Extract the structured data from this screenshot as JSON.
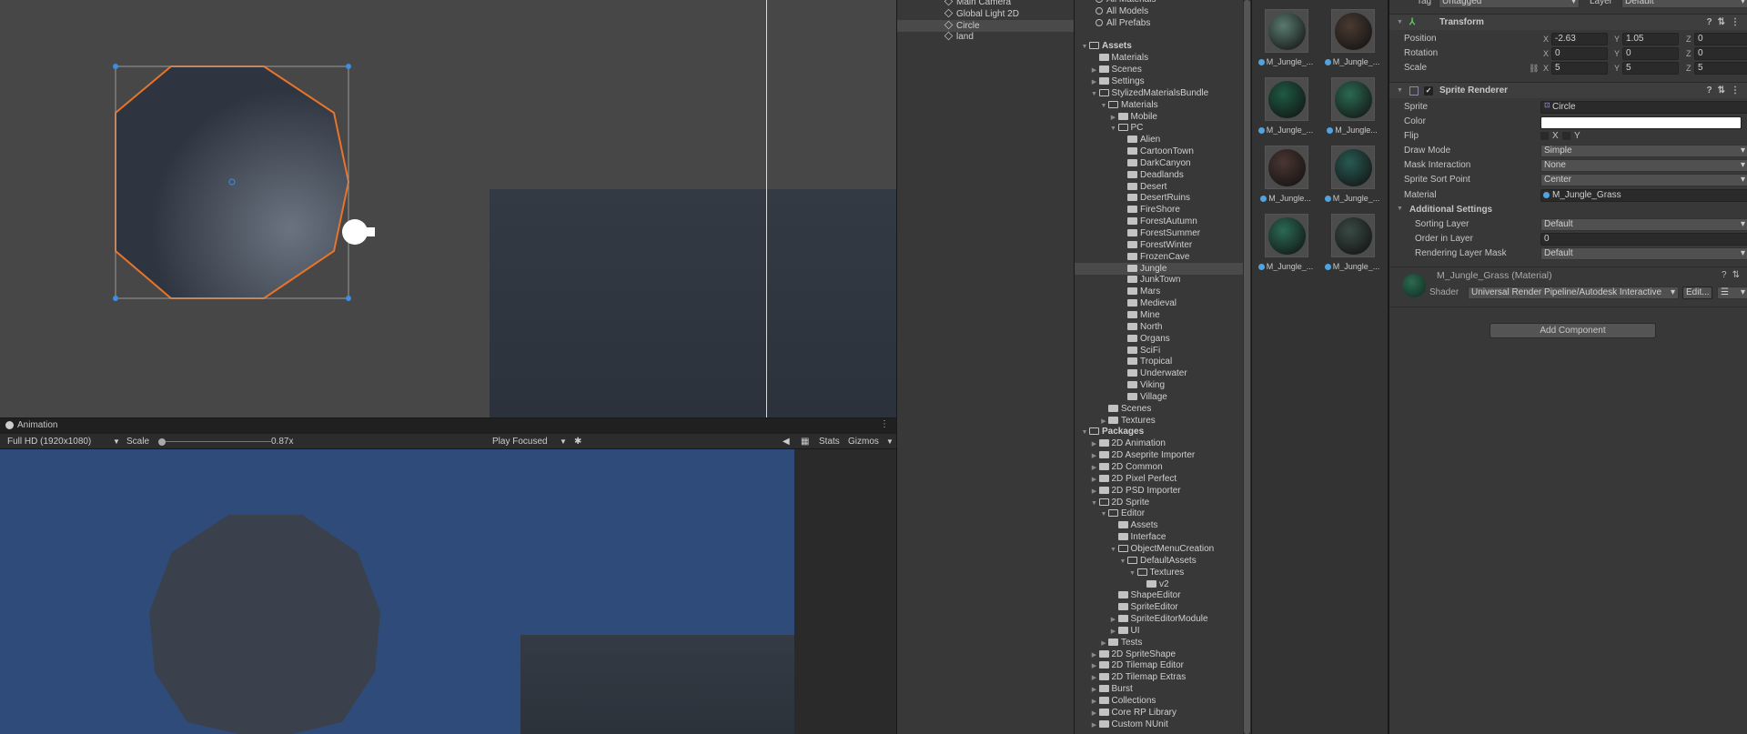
{
  "hierarchy": {
    "items": [
      {
        "label": "Main Camera"
      },
      {
        "label": "Global Light 2D"
      },
      {
        "label": "Circle",
        "selected": true
      },
      {
        "label": "land"
      }
    ]
  },
  "project": {
    "tree": [
      {
        "label": "All Materials",
        "search": true,
        "level": 0
      },
      {
        "label": "All Models",
        "search": true,
        "level": 0
      },
      {
        "label": "All Prefabs",
        "search": true,
        "level": 0
      },
      {
        "label": "",
        "level": 0,
        "blank": true
      },
      {
        "label": "Assets",
        "level": 0,
        "arrow": "open",
        "bold": true
      },
      {
        "label": "Materials",
        "level": 1
      },
      {
        "label": "Scenes",
        "level": 1,
        "arrow": "closed"
      },
      {
        "label": "Settings",
        "level": 1,
        "arrow": "closed"
      },
      {
        "label": "StylizedMaterialsBundle",
        "level": 1,
        "arrow": "open"
      },
      {
        "label": "Materials",
        "level": 2,
        "arrow": "open"
      },
      {
        "label": "Mobile",
        "level": 3,
        "arrow": "closed"
      },
      {
        "label": "PC",
        "level": 3,
        "arrow": "open"
      },
      {
        "label": "Alien",
        "level": 4
      },
      {
        "label": "CartoonTown",
        "level": 4
      },
      {
        "label": "DarkCanyon",
        "level": 4
      },
      {
        "label": "Deadlands",
        "level": 4
      },
      {
        "label": "Desert",
        "level": 4
      },
      {
        "label": "DesertRuins",
        "level": 4
      },
      {
        "label": "FireShore",
        "level": 4
      },
      {
        "label": "ForestAutumn",
        "level": 4
      },
      {
        "label": "ForestSummer",
        "level": 4
      },
      {
        "label": "ForestWinter",
        "level": 4
      },
      {
        "label": "FrozenCave",
        "level": 4
      },
      {
        "label": "Jungle",
        "level": 4,
        "selected": true
      },
      {
        "label": "JunkTown",
        "level": 4
      },
      {
        "label": "Mars",
        "level": 4
      },
      {
        "label": "Medieval",
        "level": 4
      },
      {
        "label": "Mine",
        "level": 4
      },
      {
        "label": "North",
        "level": 4
      },
      {
        "label": "Organs",
        "level": 4
      },
      {
        "label": "SciFi",
        "level": 4
      },
      {
        "label": "Tropical",
        "level": 4
      },
      {
        "label": "Underwater",
        "level": 4
      },
      {
        "label": "Viking",
        "level": 4
      },
      {
        "label": "Village",
        "level": 4
      },
      {
        "label": "Scenes",
        "level": 2
      },
      {
        "label": "Textures",
        "level": 2,
        "arrow": "closed"
      },
      {
        "label": "Packages",
        "level": 0,
        "arrow": "open",
        "bold": true
      },
      {
        "label": "2D Animation",
        "level": 1,
        "arrow": "closed"
      },
      {
        "label": "2D Aseprite Importer",
        "level": 1,
        "arrow": "closed"
      },
      {
        "label": "2D Common",
        "level": 1,
        "arrow": "closed"
      },
      {
        "label": "2D Pixel Perfect",
        "level": 1,
        "arrow": "closed"
      },
      {
        "label": "2D PSD Importer",
        "level": 1,
        "arrow": "closed"
      },
      {
        "label": "2D Sprite",
        "level": 1,
        "arrow": "open"
      },
      {
        "label": "Editor",
        "level": 2,
        "arrow": "open"
      },
      {
        "label": "Assets",
        "level": 3
      },
      {
        "label": "Interface",
        "level": 3
      },
      {
        "label": "ObjectMenuCreation",
        "level": 3,
        "arrow": "open"
      },
      {
        "label": "DefaultAssets",
        "level": 4,
        "arrow": "open"
      },
      {
        "label": "Textures",
        "level": 5,
        "arrow": "open"
      },
      {
        "label": "v2",
        "level": 6
      },
      {
        "label": "ShapeEditor",
        "level": 3
      },
      {
        "label": "SpriteEditor",
        "level": 3
      },
      {
        "label": "SpriteEditorModule",
        "level": 3,
        "arrow": "closed"
      },
      {
        "label": "UI",
        "level": 3,
        "arrow": "closed"
      },
      {
        "label": "Tests",
        "level": 2,
        "arrow": "closed"
      },
      {
        "label": "2D SpriteShape",
        "level": 1,
        "arrow": "closed"
      },
      {
        "label": "2D Tilemap Editor",
        "level": 1,
        "arrow": "closed"
      },
      {
        "label": "2D Tilemap Extras",
        "level": 1,
        "arrow": "closed"
      },
      {
        "label": "Burst",
        "level": 1,
        "arrow": "closed"
      },
      {
        "label": "Collections",
        "level": 1,
        "arrow": "closed"
      },
      {
        "label": "Core RP Library",
        "level": 1,
        "arrow": "closed"
      },
      {
        "label": "Custom NUnit",
        "level": 1,
        "arrow": "closed"
      }
    ]
  },
  "assets": [
    {
      "label": "M_Jungle_...",
      "color": "#5a7a70"
    },
    {
      "label": "M_Jungle_...",
      "color": "#4a3a32"
    },
    {
      "label": "M_Jungle_...",
      "color": "#1f5a44"
    },
    {
      "label": "M_Jungle...",
      "color": "#2a6a52"
    },
    {
      "label": "M_Jungle...",
      "color": "#4a3632"
    },
    {
      "label": "M_Jungle_...",
      "color": "#285a52"
    },
    {
      "label": "M_Jungle_...",
      "color": "#2a6a55"
    },
    {
      "label": "M_Jungle_...",
      "color": "#3a4a44"
    }
  ],
  "animation_tab": {
    "label": "Animation"
  },
  "game_toolbar": {
    "resolution": "Full HD (1920x1080)",
    "scale_label": "Scale",
    "scale_value": "0.87x",
    "scale_fraction": 0.0,
    "play_mode": "Play Focused",
    "stats": "Stats",
    "gizmos": "Gizmos"
  },
  "inspector": {
    "tag_label": "Tag",
    "tag_value": "Untagged",
    "layer_label": "Layer",
    "layer_value": "Default",
    "transform": {
      "title": "Transform",
      "rows": [
        {
          "label": "Position",
          "x": "-2.63",
          "y": "1.05",
          "z": "0"
        },
        {
          "label": "Rotation",
          "x": "0",
          "y": "0",
          "z": "0"
        },
        {
          "label": "Scale",
          "x": "5",
          "y": "5",
          "z": "5"
        }
      ]
    },
    "sprite_renderer": {
      "title": "Sprite Renderer",
      "sprite_label": "Sprite",
      "sprite_value": "Circle",
      "color_label": "Color",
      "color_value": "#ffffff",
      "flip_label": "Flip",
      "flip_x": "X",
      "flip_y": "Y",
      "draw_mode_label": "Draw Mode",
      "draw_mode_value": "Simple",
      "mask_label": "Mask Interaction",
      "mask_value": "None",
      "sort_point_label": "Sprite Sort Point",
      "sort_point_value": "Center",
      "material_label": "Material",
      "material_value": "M_Jungle_Grass",
      "additional_label": "Additional Settings",
      "sorting_layer_label": "Sorting Layer",
      "sorting_layer_value": "Default",
      "order_label": "Order in Layer",
      "order_value": "0",
      "rlm_label": "Rendering Layer Mask",
      "rlm_value": "Default"
    },
    "material": {
      "title": "M_Jungle_Grass (Material)",
      "shader_label": "Shader",
      "shader_value": "Universal Render Pipeline/Autodesk Interactive",
      "edit_label": "Edit..."
    },
    "add_component": "Add Component"
  },
  "colors": {
    "selection_outline": "#e8742a",
    "game_bg": "#2f4b79"
  }
}
